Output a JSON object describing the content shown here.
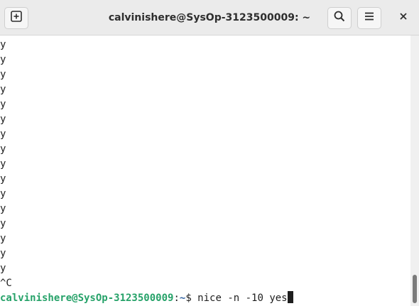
{
  "window": {
    "title": "calvinishere@SysOp-3123500009: ~",
    "new_tab_icon": "new-tab-icon",
    "search_icon": "search-icon",
    "menu_icon": "hamburger-menu-icon",
    "close_icon": "close-icon"
  },
  "terminal": {
    "output_lines": [
      "y",
      "y",
      "y",
      "y",
      "y",
      "y",
      "y",
      "y",
      "y",
      "y",
      "y",
      "y",
      "y",
      "y",
      "y",
      "y"
    ],
    "interrupt_line": "^C",
    "prompt": {
      "user_host": "calvinishere@SysOp-3123500009",
      "separator": ":",
      "path": "~",
      "symbol": "$ ",
      "command": "nice -n -10 yes"
    }
  },
  "colors": {
    "prompt_user_host": "#26a269",
    "prompt_path": "#3465a4",
    "text": "#1e1e1e",
    "titlebar": "#ebebeb"
  }
}
